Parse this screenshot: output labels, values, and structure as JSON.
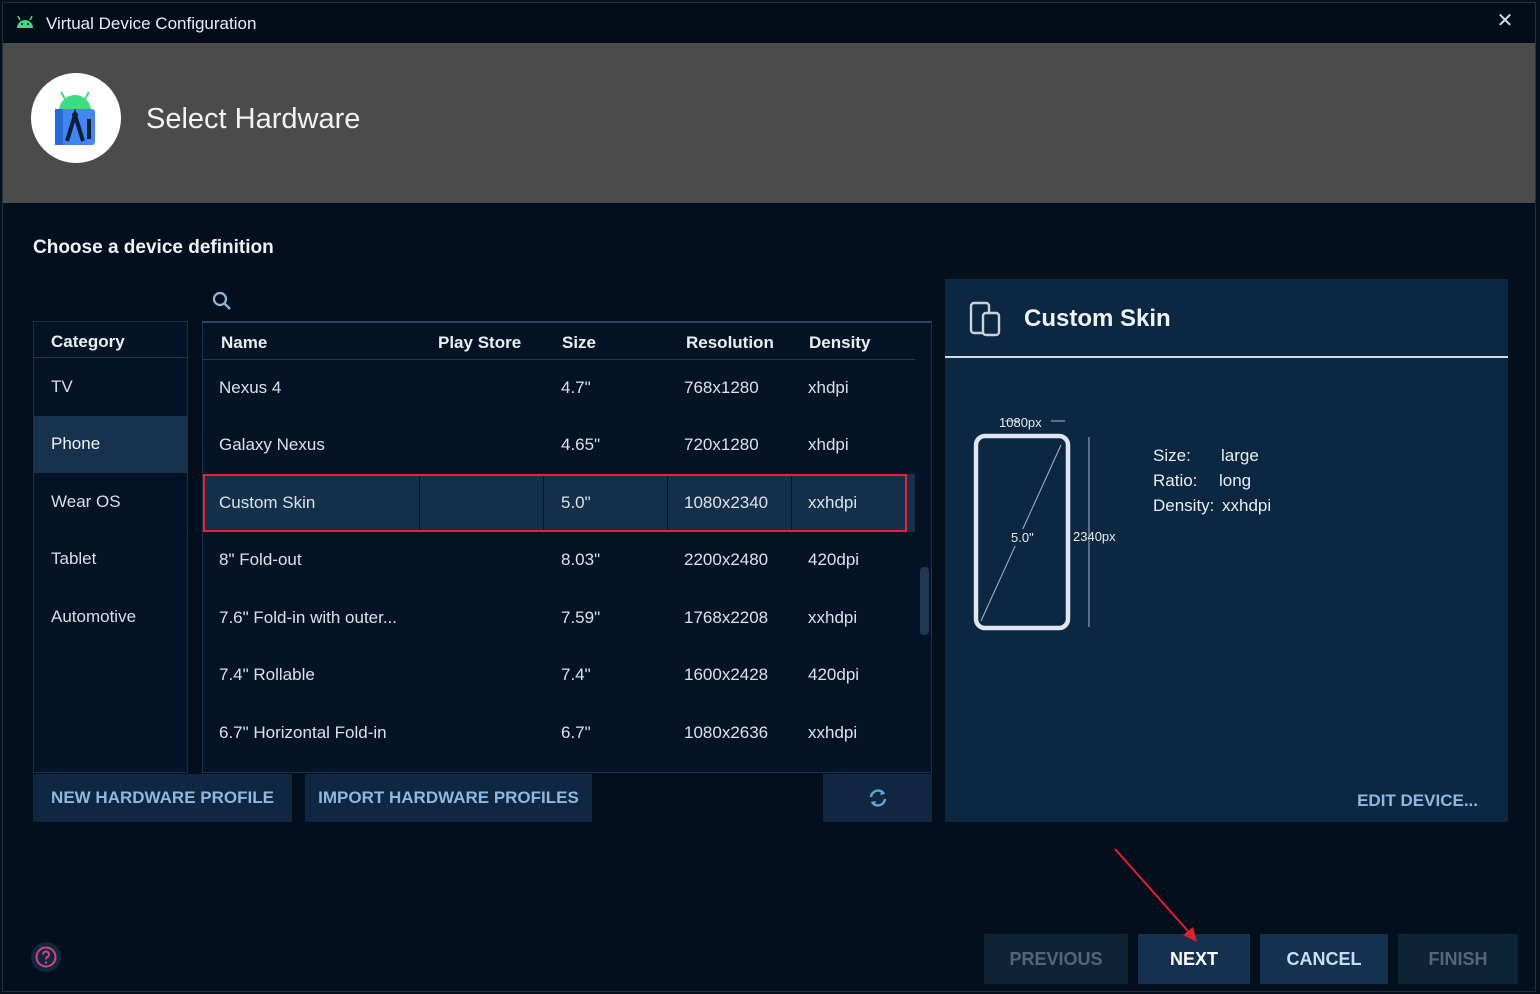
{
  "window": {
    "title": "Virtual Device Configuration",
    "close_symbol": "✕"
  },
  "header": {
    "heading": "Select Hardware",
    "logo_icon": "android-studio-logo"
  },
  "content": {
    "subtitle": "Choose a device definition",
    "search_icon": "search-icon"
  },
  "category": {
    "header": "Category",
    "items": [
      {
        "label": "TV"
      },
      {
        "label": "Phone",
        "selected": true
      },
      {
        "label": "Wear OS"
      },
      {
        "label": "Tablet"
      },
      {
        "label": "Automotive"
      }
    ]
  },
  "table": {
    "columns": [
      "Name",
      "Play Store",
      "Size",
      "Resolution",
      "Density"
    ],
    "rows": [
      {
        "name": "Nexus 4",
        "play_store": "",
        "size": "4.7\"",
        "resolution": "768x1280",
        "density": "xhdpi"
      },
      {
        "name": "Galaxy Nexus",
        "play_store": "",
        "size": "4.65\"",
        "resolution": "720x1280",
        "density": "xhdpi"
      },
      {
        "name": "Custom Skin",
        "play_store": "",
        "size": "5.0\"",
        "resolution": "1080x2340",
        "density": "xxhdpi",
        "selected": true
      },
      {
        "name": "8\" Fold-out",
        "play_store": "",
        "size": "8.03\"",
        "resolution": "2200x2480",
        "density": "420dpi"
      },
      {
        "name": "7.6\" Fold-in with outer...",
        "play_store": "",
        "size": "7.59\"",
        "resolution": "1768x2208",
        "density": "xxhdpi"
      },
      {
        "name": "7.4\" Rollable",
        "play_store": "",
        "size": "7.4\"",
        "resolution": "1600x2428",
        "density": "420dpi"
      },
      {
        "name": "6.7\" Horizontal Fold-in",
        "play_store": "",
        "size": "6.7\"",
        "resolution": "1080x2636",
        "density": "xxhdpi"
      }
    ]
  },
  "actions": {
    "new_profile": "NEW HARDWARE PROFILE",
    "import_profiles": "IMPORT HARDWARE PROFILES",
    "refresh_icon": "refresh-icon"
  },
  "details": {
    "title": "Custom Skin",
    "device_icon": "devices-icon",
    "diagram": {
      "width_label": "1080px",
      "height_label": "2340px",
      "diagonal_label": "5.0\""
    },
    "specs": {
      "size_key": "Size:",
      "size_val": "large",
      "ratio_key": "Ratio:",
      "ratio_val": "long",
      "density_key": "Density:",
      "density_val": "xxhdpi"
    },
    "edit": "EDIT DEVICE..."
  },
  "footer": {
    "help_icon": "help-icon",
    "previous": "PREVIOUS",
    "next": "NEXT",
    "cancel": "CANCEL",
    "finish": "FINISH"
  },
  "colors": {
    "accent_text": "#8db8e1",
    "selection_border": "#e0262e",
    "banner": "#4b4b4b",
    "panel": "#0c2741"
  }
}
